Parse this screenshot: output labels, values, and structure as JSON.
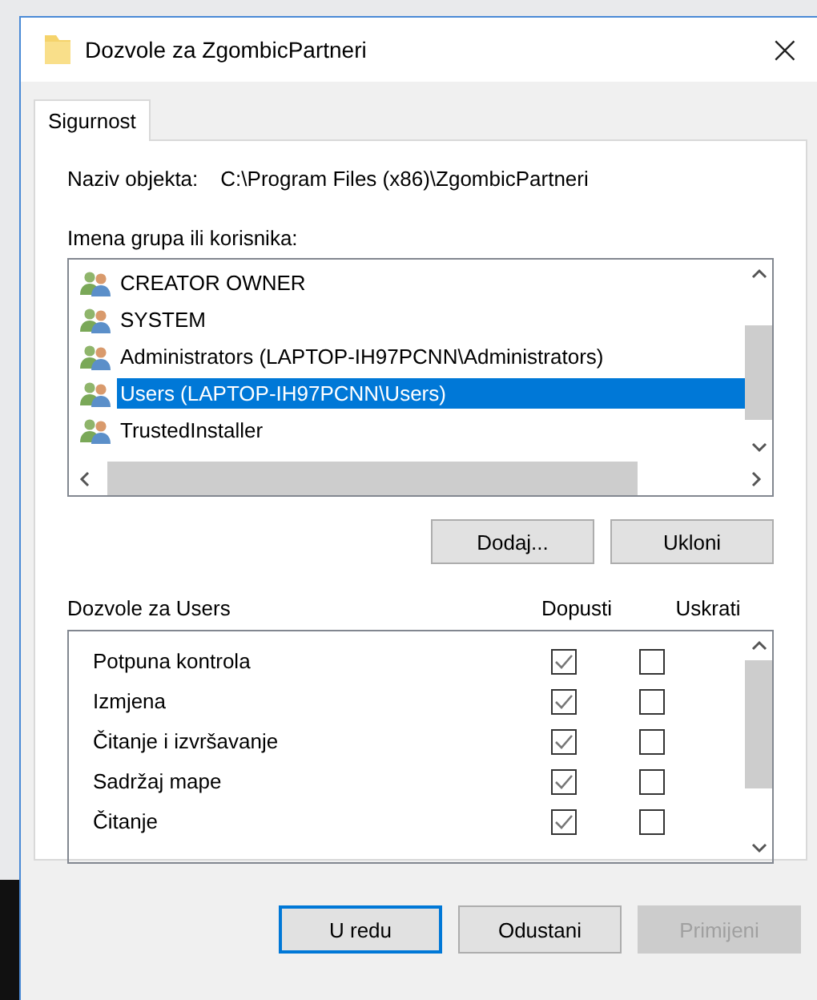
{
  "window": {
    "title": "Dozvole za ZgombicPartneri",
    "close": "×"
  },
  "tabs": [
    {
      "label": "Sigurnost",
      "selected": true
    }
  ],
  "object_name": {
    "label": "Naziv objekta:",
    "value": "C:\\Program Files (x86)\\ZgombicPartneri"
  },
  "principals": {
    "label": "Imena grupa ili korisnika:",
    "items": [
      {
        "name": "CREATOR OWNER",
        "selected": false
      },
      {
        "name": "SYSTEM",
        "selected": false
      },
      {
        "name": "Administrators (LAPTOP-IH97PCNN\\Administrators)",
        "selected": false
      },
      {
        "name": "Users (LAPTOP-IH97PCNN\\Users)",
        "selected": true
      },
      {
        "name": "TrustedInstaller",
        "selected": false
      }
    ]
  },
  "principal_buttons": [
    {
      "label": "Dodaj...",
      "disabled": false
    },
    {
      "label": "Ukloni",
      "disabled": false
    }
  ],
  "permissions": {
    "title": "Dozvole za Users",
    "allow_header": "Dopusti",
    "deny_header": "Uskrati",
    "rows": [
      {
        "name": "Potpuna kontrola",
        "allow": true,
        "deny": false
      },
      {
        "name": "Izmjena",
        "allow": true,
        "deny": false
      },
      {
        "name": "Čitanje i izvršavanje",
        "allow": true,
        "deny": false
      },
      {
        "name": "Sadržaj mape",
        "allow": true,
        "deny": false
      },
      {
        "name": "Čitanje",
        "allow": true,
        "deny": false
      }
    ]
  },
  "buttons": [
    {
      "label": "U redu",
      "default": true,
      "disabled": false
    },
    {
      "label": "Odustani",
      "default": false,
      "disabled": false
    },
    {
      "label": "Primijeni",
      "default": false,
      "disabled": true
    }
  ]
}
